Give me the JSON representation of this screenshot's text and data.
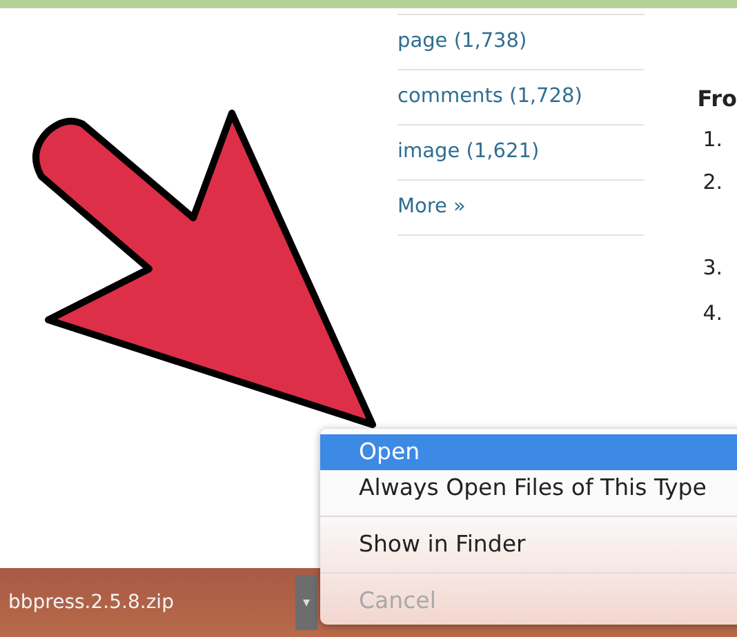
{
  "tags": [
    {
      "label": "page (1,738)"
    },
    {
      "label": "comments (1,728)"
    },
    {
      "label": "image (1,621)"
    },
    {
      "label": "More »"
    }
  ],
  "side_section": {
    "heading": "Fro",
    "numbers": [
      "1.",
      "2.",
      "3.",
      "4."
    ]
  },
  "download_bar": {
    "filename": "bbpress.2.5.8.zip",
    "menu_button": "▾"
  },
  "context_menu": {
    "groups": [
      [
        {
          "label": "Open",
          "selected": true,
          "disabled": false
        },
        {
          "label": "Always Open Files of This Type",
          "selected": false,
          "disabled": false
        }
      ],
      [
        {
          "label": "Show in Finder",
          "selected": false,
          "disabled": false
        }
      ],
      [
        {
          "label": "Cancel",
          "selected": false,
          "disabled": true
        }
      ]
    ]
  }
}
